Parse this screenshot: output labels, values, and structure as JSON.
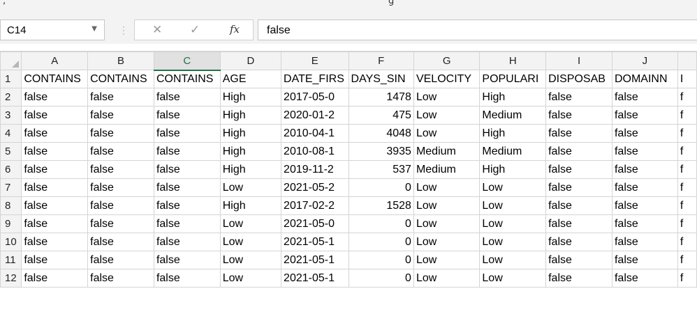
{
  "name_box": {
    "value": "C14"
  },
  "formula": {
    "value": "false",
    "fx_label": "fx"
  },
  "columns": [
    "A",
    "B",
    "C",
    "D",
    "E",
    "F",
    "G",
    "H",
    "I",
    "J"
  ],
  "selected_column": "C",
  "rows": [
    {
      "n": "1",
      "cells": [
        "CONTAINS",
        "CONTAINS",
        "CONTAINS",
        "AGE",
        "DATE_FIRS",
        "DAYS_SIN",
        "VELOCITY",
        "POPULARI",
        "DISPOSAB",
        "DOMAINN",
        "I"
      ]
    },
    {
      "n": "2",
      "cells": [
        "false",
        "false",
        "false",
        "High",
        "2017-05-0",
        "1478",
        "Low",
        "High",
        "false",
        "false",
        "f"
      ]
    },
    {
      "n": "3",
      "cells": [
        "false",
        "false",
        "false",
        "High",
        "2020-01-2",
        "475",
        "Low",
        "Medium",
        "false",
        "false",
        "f"
      ]
    },
    {
      "n": "4",
      "cells": [
        "false",
        "false",
        "false",
        "High",
        "2010-04-1",
        "4048",
        "Low",
        "High",
        "false",
        "false",
        "f"
      ]
    },
    {
      "n": "5",
      "cells": [
        "false",
        "false",
        "false",
        "High",
        "2010-08-1",
        "3935",
        "Medium",
        "Medium",
        "false",
        "false",
        "f"
      ]
    },
    {
      "n": "6",
      "cells": [
        "false",
        "false",
        "false",
        "High",
        "2019-11-2",
        "537",
        "Medium",
        "High",
        "false",
        "false",
        "f"
      ]
    },
    {
      "n": "7",
      "cells": [
        "false",
        "false",
        "false",
        "Low",
        "2021-05-2",
        "0",
        "Low",
        "Low",
        "false",
        "false",
        "f"
      ]
    },
    {
      "n": "8",
      "cells": [
        "false",
        "false",
        "false",
        "High",
        "2017-02-2",
        "1528",
        "Low",
        "Low",
        "false",
        "false",
        "f"
      ]
    },
    {
      "n": "9",
      "cells": [
        "false",
        "false",
        "false",
        "Low",
        "2021-05-0",
        "0",
        "Low",
        "Low",
        "false",
        "false",
        "f"
      ]
    },
    {
      "n": "10",
      "cells": [
        "false",
        "false",
        "false",
        "Low",
        "2021-05-1",
        "0",
        "Low",
        "Low",
        "false",
        "false",
        "f"
      ]
    },
    {
      "n": "11",
      "cells": [
        "false",
        "false",
        "false",
        "Low",
        "2021-05-1",
        "0",
        "Low",
        "Low",
        "false",
        "false",
        "f"
      ]
    },
    {
      "n": "12",
      "cells": [
        "false",
        "false",
        "false",
        "Low",
        "2021-05-1",
        "0",
        "Low",
        "Low",
        "false",
        "false",
        "f"
      ]
    }
  ]
}
